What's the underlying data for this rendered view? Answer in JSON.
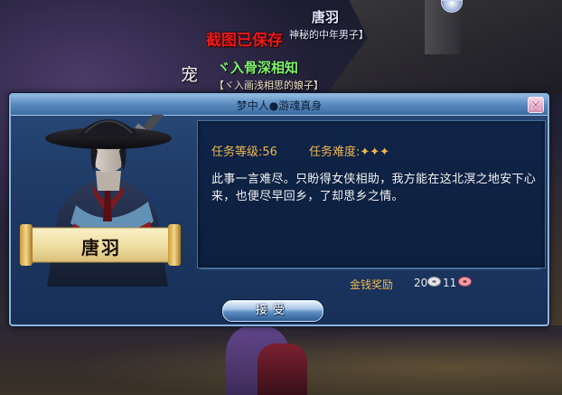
{
  "world": {
    "npc_name": "唐羽",
    "npc_title": "神秘的中年男子】",
    "screenshot_notice": "截图已保存",
    "pet_label": "宠",
    "guild_name": "ヾ入骨深相知",
    "guild_title": "【ヾ入画浅相思的娘子】"
  },
  "dialog": {
    "title": "梦中人●游魂真身",
    "portrait_name": "唐羽",
    "task_level": "任务等级:56",
    "task_difficulty": "任务难度:✦✦✦",
    "description": "此事一言难尽。只盼得女侠相助，我方能在这北溟之地安下心来，也便尽早回乡，了却思乡之情。",
    "reward_label": "金钱奖励",
    "reward_silver": "20",
    "reward_copper": "11",
    "accept_label": "接受"
  },
  "colors": {
    "dialog_bg": "#1e3a66",
    "accent_gold": "#f0b650",
    "guild_green": "#7cf26a",
    "notice_red": "#e41a1a"
  },
  "icons": [
    "close-icon",
    "silver-coin-icon",
    "copper-coin-icon"
  ]
}
